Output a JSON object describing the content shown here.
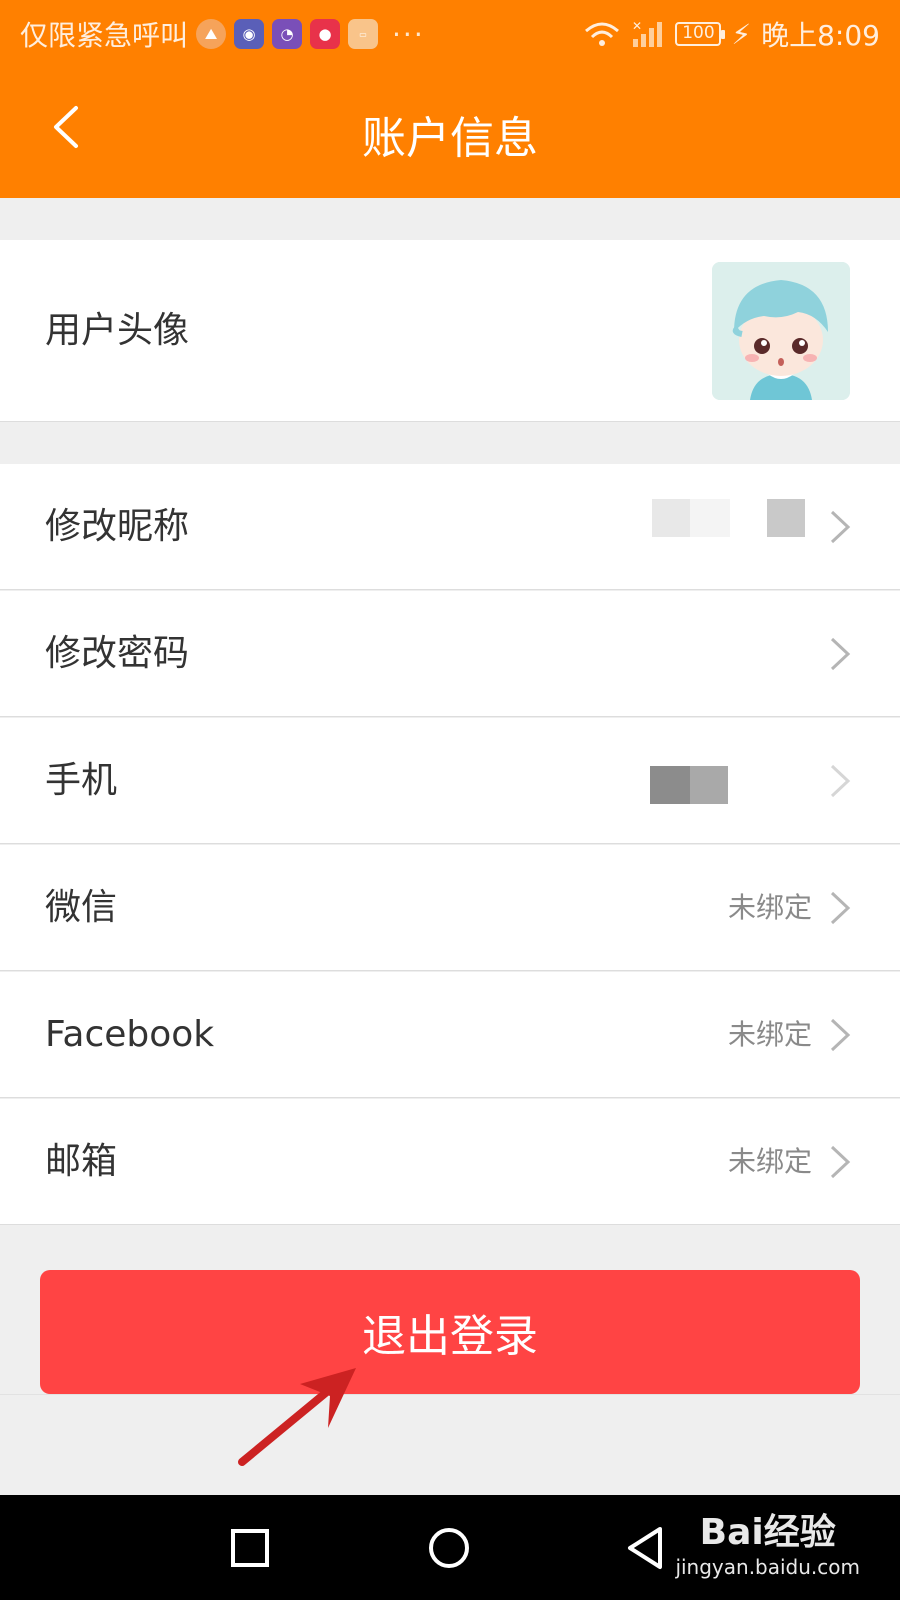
{
  "status_bar": {
    "carrier_text": "仅限紧急呼叫",
    "more": "···",
    "battery": "100",
    "time": "晚上8:09"
  },
  "header": {
    "title": "账户信息"
  },
  "avatar_row": {
    "label": "用户头像"
  },
  "rows": [
    {
      "label": "修改昵称",
      "value": ""
    },
    {
      "label": "修改密码",
      "value": ""
    },
    {
      "label": "手机",
      "value": ""
    },
    {
      "label": "微信",
      "value": "未绑定"
    },
    {
      "label": "Facebook",
      "value": "未绑定"
    },
    {
      "label": "邮箱",
      "value": "未绑定"
    }
  ],
  "logout": {
    "label": "退出登录"
  },
  "colors": {
    "header": "#ff8000",
    "logout": "#ff4444",
    "background": "#efefef"
  },
  "watermark": {
    "main": "Bai经验",
    "sub": "jingyan.baidu.com"
  }
}
